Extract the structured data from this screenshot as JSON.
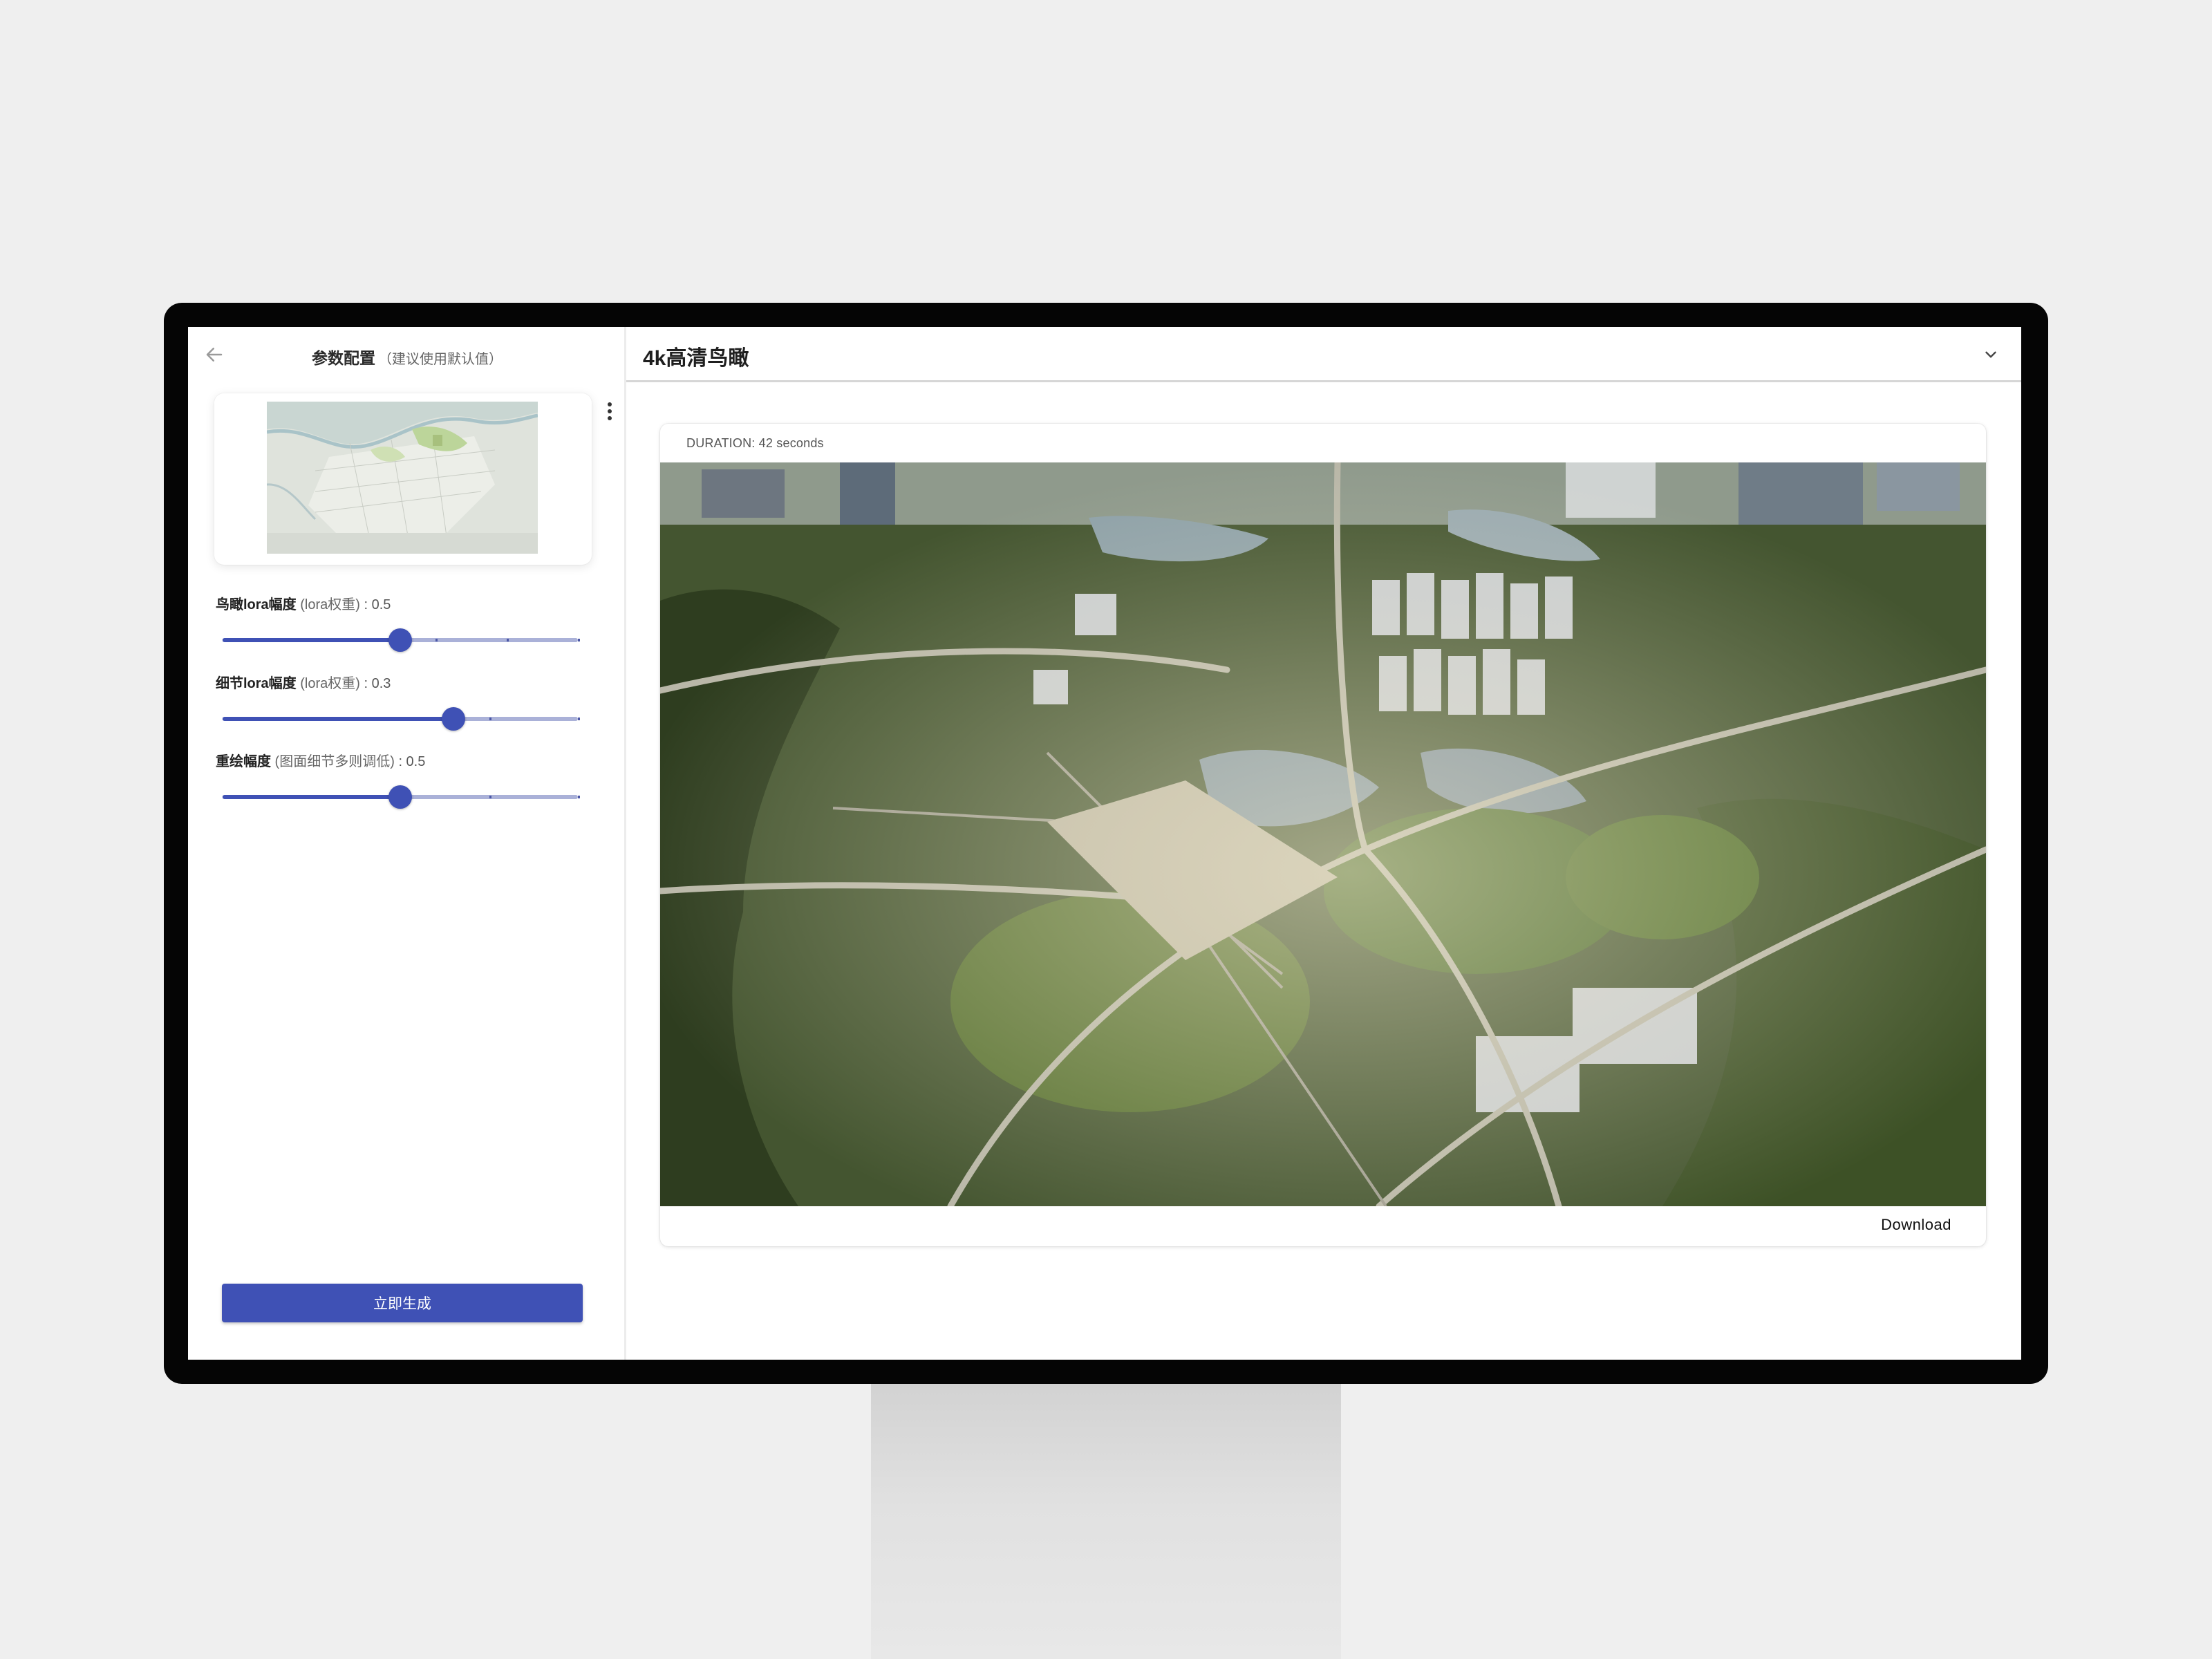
{
  "left_panel": {
    "title": "参数配置",
    "subtitle": "（建议使用默认值）",
    "sliders": [
      {
        "label": "鸟瞰lora幅度",
        "hint": " (lora权重)",
        "value_text": " : 0.5",
        "value": 0.5,
        "min": 0,
        "max": 1
      },
      {
        "label": "细节lora幅度",
        "hint": " (lora权重)",
        "value_text": " : 0.3",
        "value": 0.3,
        "min": -1,
        "max": 1
      },
      {
        "label": "重绘幅度",
        "hint": " (图面细节多则调低)",
        "value_text": " : 0.5",
        "value": 0.5,
        "min": 0,
        "max": 1
      }
    ],
    "generate_label": "立即生成"
  },
  "right_panel": {
    "title": "4k高清鸟瞰",
    "duration_text": "DURATION: 42 seconds",
    "download_label": "Download"
  },
  "icons": {
    "back": "arrow-left-icon",
    "more": "more-vertical-icon",
    "collapse": "chevron-down-icon"
  },
  "colors": {
    "accent": "#3f51b5",
    "track": "#aab1d8",
    "background": "#efefef"
  }
}
